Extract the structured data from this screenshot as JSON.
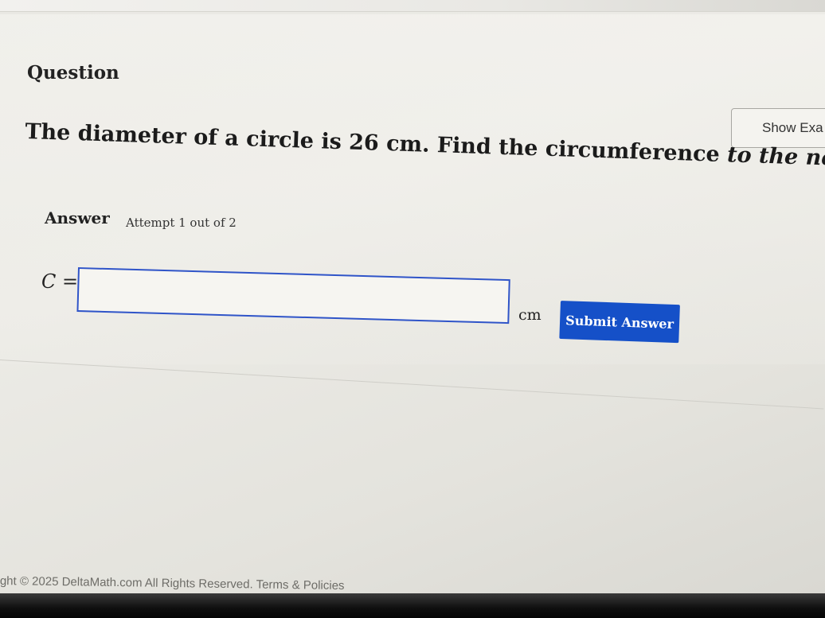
{
  "question": {
    "heading": "Question",
    "text_plain": "The diameter of a circle is 26 cm. Find the circumference ",
    "text_italic": "to the nearest whole number."
  },
  "show_example": {
    "label": "Show Exa"
  },
  "answer": {
    "label": "Answer",
    "attempt": "Attempt 1 out of 2",
    "equation_var": "C",
    "equation_eq": " =",
    "input_value": "",
    "unit": "cm",
    "submit_label": "Submit Answer"
  },
  "footer": {
    "copyright": "ght © 2025 DeltaMath.com All Rights Reserved.",
    "terms_link": "Terms & Policies"
  },
  "colors": {
    "accent": "#1550c8",
    "input_border": "#2f54c8",
    "background": "#eaeae5"
  }
}
